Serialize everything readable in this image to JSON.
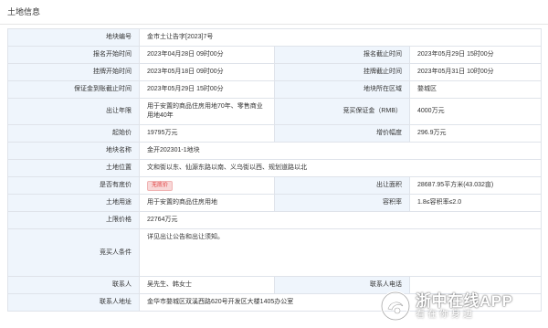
{
  "panel_title": "土地信息",
  "fields": {
    "plot_no": {
      "label": "地块编号",
      "value": "金市土让告字[2023]7号"
    },
    "reg_start": {
      "label": "报名开始时间",
      "value": "2023年04月28日 09时00分"
    },
    "reg_end": {
      "label": "报名截止时间",
      "value": "2023年05月29日 15时00分"
    },
    "listing_start": {
      "label": "挂牌开始时间",
      "value": "2023年05月18日 09时00分"
    },
    "listing_end": {
      "label": "挂牌截止时间",
      "value": "2023年05月31日 10时00分"
    },
    "deposit_deadline": {
      "label": "保证金到账截止时间",
      "value": "2023年05月29日 15时00分"
    },
    "district": {
      "label": "地块所在区域",
      "value": "婺城区"
    },
    "term": {
      "label": "出让年限",
      "value": "用于安置的商品住房用地70年、零售商业用地40年"
    },
    "deposit": {
      "label": "竞买保证金（RMB）",
      "value": "4000万元"
    },
    "starting_price": {
      "label": "起始价",
      "value": "19795万元"
    },
    "increment": {
      "label": "增价幅度",
      "value": "296.9万元"
    },
    "plot_name": {
      "label": "地块名称",
      "value": "金开202301-1地块"
    },
    "location": {
      "label": "土地位置",
      "value": "文和街以东、仙源东路以南、义乌街以西、规划道路以北"
    },
    "reserve_price": {
      "label": "是否有底价",
      "value": "无底价"
    },
    "area": {
      "label": "出让面积",
      "value": "28687.95平方米(43.032亩)"
    },
    "usage": {
      "label": "土地用途",
      "value": "用于安置的商品住房用地"
    },
    "far": {
      "label": "容积率",
      "value": "1.8≤容积率≤2.0"
    },
    "cap_price": {
      "label": "上限价格",
      "value": "22764万元"
    },
    "bidder_req": {
      "label": "竞买人条件",
      "value": "详见出让公告和出让须知。"
    },
    "contact": {
      "label": "联系人",
      "value": "吴先生、韩女士"
    },
    "contact_phone": {
      "label": "联系人电话",
      "value": ""
    },
    "contact_addr": {
      "label": "联系人地址",
      "value": "金华市婺城区双溪西路620号开发区大楼1405办公室"
    }
  },
  "watermark": {
    "title": "浙中在线APP",
    "subtitle": "看在你身边"
  },
  "colors": {
    "label_bg": "#eff5fc",
    "border": "#dfe3ea",
    "badge_bg": "#f8d7d7",
    "badge_text": "#e04040"
  }
}
